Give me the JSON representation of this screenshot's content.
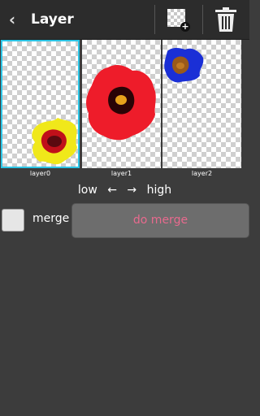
{
  "header": {
    "title": "Layer",
    "back_icon": "chevron-left-icon",
    "add_icon": "add-layer-icon",
    "delete_icon": "trash-icon"
  },
  "layers": [
    {
      "label": "layer0",
      "selected": true,
      "image": "yellow flower at bottom-left"
    },
    {
      "label": "layer1",
      "selected": false,
      "image": "red flower in center"
    },
    {
      "label": "layer2",
      "selected": false,
      "image": "blue flower at top-left"
    }
  ],
  "order": {
    "low": "low",
    "arrow_left": "←",
    "arrow_right": "→",
    "high": "high"
  },
  "merge": {
    "label": "merge",
    "checked": false,
    "button_label": "do merge"
  },
  "colors": {
    "accent_selected": "#2cc5e6",
    "merge_text": "#e86a8e"
  }
}
